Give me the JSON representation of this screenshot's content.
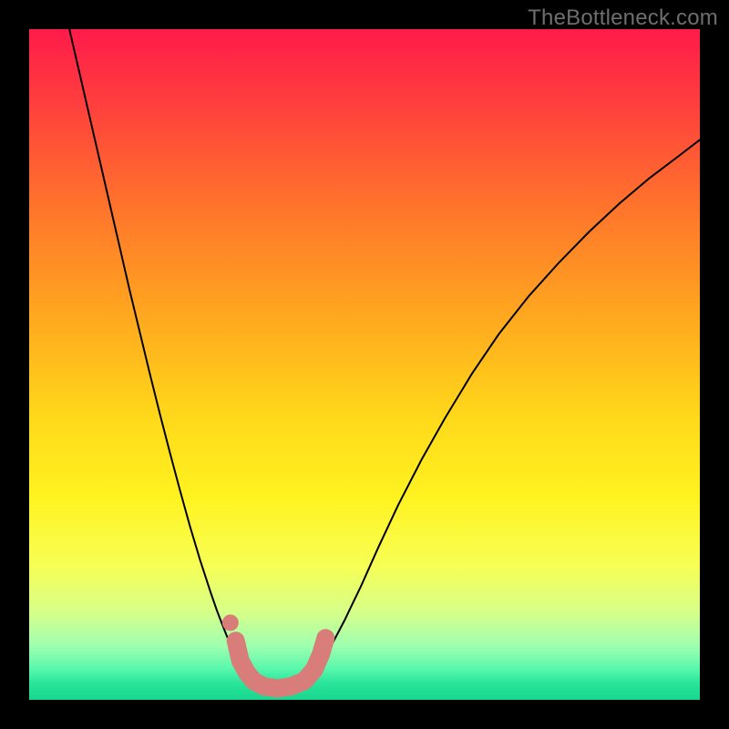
{
  "watermark": "TheBottleneck.com",
  "chart_data": {
    "type": "line",
    "title": "",
    "xlabel": "",
    "ylabel": "",
    "xlim": [
      0,
      1
    ],
    "ylim": [
      0,
      1
    ],
    "background_gradient": {
      "stops": [
        {
          "offset": 0.0,
          "color": "#ff1b4a"
        },
        {
          "offset": 0.1,
          "color": "#ff3b3f"
        },
        {
          "offset": 0.25,
          "color": "#ff6f2d"
        },
        {
          "offset": 0.42,
          "color": "#ffa51f"
        },
        {
          "offset": 0.58,
          "color": "#ffd91a"
        },
        {
          "offset": 0.7,
          "color": "#fff321"
        },
        {
          "offset": 0.8,
          "color": "#f7ff55"
        },
        {
          "offset": 0.87,
          "color": "#d6ff8a"
        },
        {
          "offset": 0.92,
          "color": "#9effb0"
        },
        {
          "offset": 0.955,
          "color": "#55f7ac"
        },
        {
          "offset": 0.975,
          "color": "#2ae59b"
        },
        {
          "offset": 1.0,
          "color": "#18d68f"
        }
      ]
    },
    "series": [
      {
        "name": "left-curve",
        "stroke": "#000000",
        "x": [
          0.06,
          0.075,
          0.09,
          0.105,
          0.12,
          0.135,
          0.15,
          0.165,
          0.18,
          0.195,
          0.21,
          0.225,
          0.24,
          0.255,
          0.27,
          0.28,
          0.29,
          0.3,
          0.31,
          0.32,
          0.33
        ],
        "y": [
          1.0,
          0.935,
          0.87,
          0.805,
          0.74,
          0.675,
          0.61,
          0.548,
          0.486,
          0.426,
          0.368,
          0.312,
          0.258,
          0.208,
          0.162,
          0.133,
          0.107,
          0.082,
          0.06,
          0.042,
          0.028
        ]
      },
      {
        "name": "right-curve",
        "stroke": "#000000",
        "x": [
          0.42,
          0.435,
          0.45,
          0.47,
          0.495,
          0.52,
          0.55,
          0.585,
          0.62,
          0.66,
          0.7,
          0.745,
          0.79,
          0.835,
          0.88,
          0.925,
          0.97,
          1.0
        ],
        "y": [
          0.028,
          0.052,
          0.08,
          0.118,
          0.17,
          0.226,
          0.29,
          0.358,
          0.42,
          0.486,
          0.545,
          0.602,
          0.652,
          0.698,
          0.74,
          0.778,
          0.812,
          0.835
        ]
      },
      {
        "name": "valley-fill",
        "stroke": "#d87d7a",
        "x": [
          0.308,
          0.315,
          0.325,
          0.335,
          0.35,
          0.37,
          0.39,
          0.41,
          0.425,
          0.435,
          0.442
        ],
        "y": [
          0.088,
          0.058,
          0.04,
          0.028,
          0.02,
          0.017,
          0.02,
          0.028,
          0.045,
          0.068,
          0.092
        ]
      },
      {
        "name": "valley-dot",
        "stroke": "#d87d7a",
        "x": [
          0.3
        ],
        "y": [
          0.115
        ]
      }
    ]
  }
}
